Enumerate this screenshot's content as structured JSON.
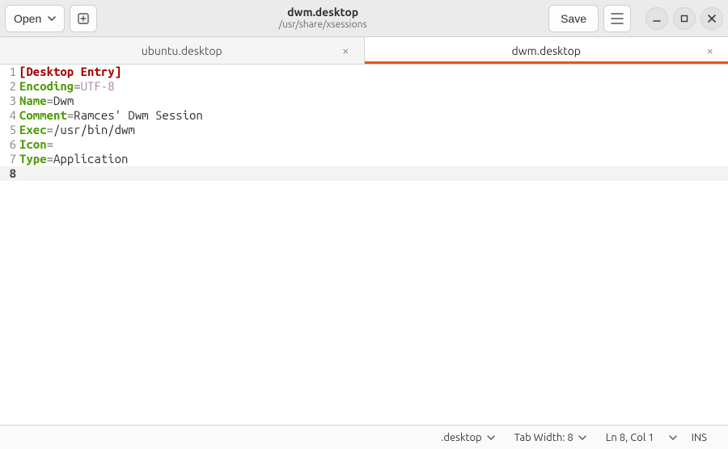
{
  "header": {
    "open_label": "Open",
    "save_label": "Save",
    "title": "dwm.desktop",
    "subtitle": "/usr/share/xsessions"
  },
  "tabs": [
    {
      "label": "ubuntu.desktop",
      "active": false
    },
    {
      "label": "dwm.desktop",
      "active": true
    }
  ],
  "code": {
    "lines": [
      {
        "n": "1",
        "type": "section",
        "section": "[Desktop Entry]"
      },
      {
        "n": "2",
        "type": "kv",
        "key": "Encoding",
        "val": "UTF-8",
        "val_class": "enc"
      },
      {
        "n": "3",
        "type": "kv",
        "key": "Name",
        "val": "Dwm"
      },
      {
        "n": "4",
        "type": "kv",
        "key": "Comment",
        "val": "Ramces' Dwm Session"
      },
      {
        "n": "5",
        "type": "kv",
        "key": "Exec",
        "val": "/usr/bin/dwm"
      },
      {
        "n": "6",
        "type": "kv",
        "key": "Icon",
        "val": ""
      },
      {
        "n": "7",
        "type": "kv",
        "key": "Type",
        "val": "Application"
      },
      {
        "n": "8",
        "type": "empty",
        "current": true
      }
    ]
  },
  "statusbar": {
    "filetype": ".desktop",
    "tab_width": "Tab Width: 8",
    "position": "Ln 8, Col 1",
    "mode": "INS"
  },
  "glyphs": {
    "chevron_down": "⌄",
    "close_x": "×"
  }
}
